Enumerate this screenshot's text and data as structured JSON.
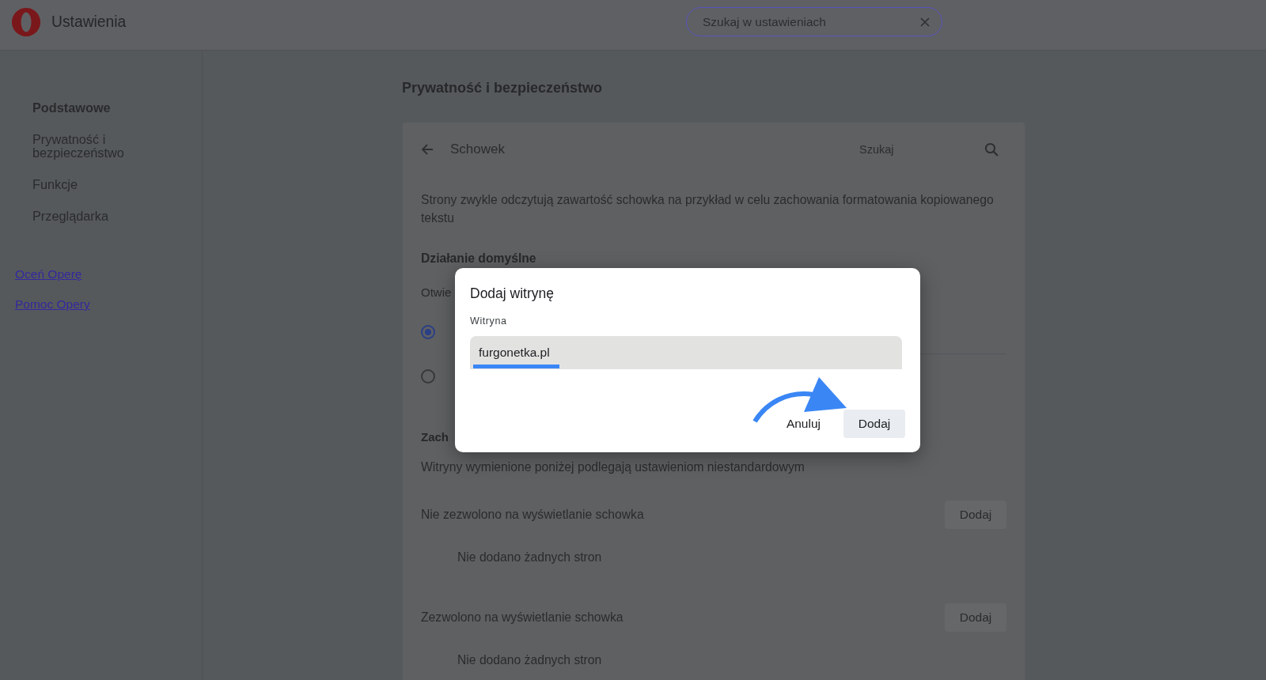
{
  "header": {
    "title": "Ustawienia",
    "search": {
      "placeholder": "Szukaj w ustawieniach"
    }
  },
  "sidebar": {
    "items": [
      {
        "label": "Podstawowe",
        "selected": true
      },
      {
        "label": "Prywatność i bezpieczeństwo",
        "selected": false
      },
      {
        "label": "Funkcje",
        "selected": false
      },
      {
        "label": "Przeglądarka",
        "selected": false
      }
    ],
    "links": [
      "Oceń Operę",
      "Pomoc Opery"
    ]
  },
  "main": {
    "heading": "Prywatność i bezpieczeństwo",
    "card": {
      "title": "Schowek",
      "search": {
        "placeholder": "Szukaj"
      },
      "description": "Strony zwykle odczytują zawartość schowka na przykład w celu zachowania formatowania kopiowanego tekstu",
      "default_behavior": {
        "heading": "Działanie domyślne",
        "text": "Otwie",
        "radios": [
          {
            "selected": true
          },
          {
            "selected": false
          }
        ]
      },
      "custom_behavior": {
        "heading": "Zach",
        "text": "Witryny wymienione poniżej podlegają ustawieniom niestandardowym",
        "lists": [
          {
            "label": "Nie zezwolono na wyświetlanie schowka",
            "button": "Dodaj",
            "empty": "Nie dodano żadnych stron"
          },
          {
            "label": "Zezwolono na wyświetlanie schowka",
            "button": "Dodaj",
            "empty": "Nie dodano żadnych stron"
          }
        ]
      }
    }
  },
  "dialog": {
    "title": "Dodaj witrynę",
    "field": {
      "label": "Witryna",
      "value": "furgonetka.pl"
    },
    "buttons": [
      {
        "label": "Anuluj",
        "kind": "text"
      },
      {
        "label": "Dodaj",
        "kind": "filled"
      }
    ]
  }
}
